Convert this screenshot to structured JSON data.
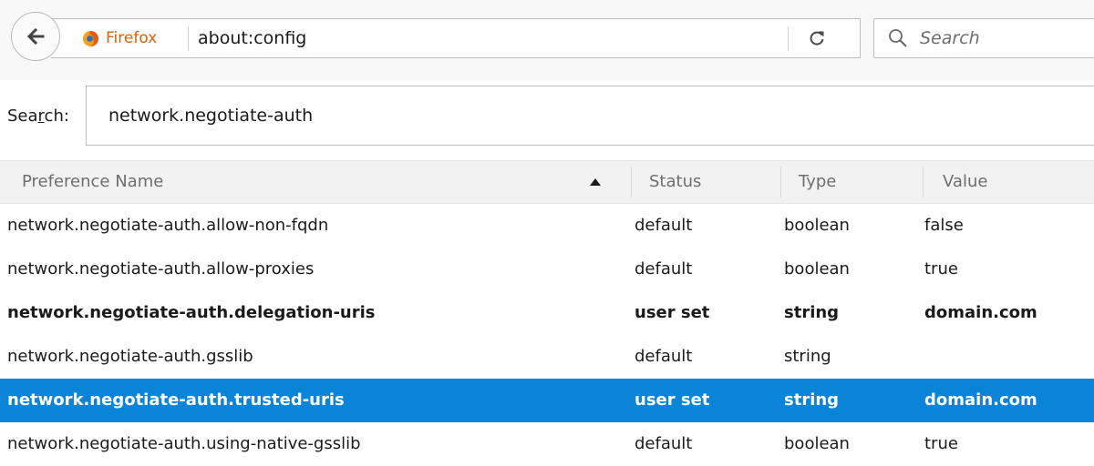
{
  "toolbar": {
    "identity_label": "Firefox",
    "url": "about:config",
    "search_placeholder": "Search"
  },
  "filter": {
    "label_before": "Sea",
    "label_access_key": "r",
    "label_after": "ch:",
    "value": "network.negotiate-auth"
  },
  "table": {
    "headers": {
      "name": "Preference Name",
      "status": "Status",
      "type": "Type",
      "value": "Value"
    },
    "rows": [
      {
        "name": "network.negotiate-auth.allow-non-fqdn",
        "status": "default",
        "type": "boolean",
        "value": "false"
      },
      {
        "name": "network.negotiate-auth.allow-proxies",
        "status": "default",
        "type": "boolean",
        "value": "true"
      },
      {
        "name": "network.negotiate-auth.delegation-uris",
        "status": "user set",
        "type": "string",
        "value": "domain.com"
      },
      {
        "name": "network.negotiate-auth.gsslib",
        "status": "default",
        "type": "string",
        "value": ""
      },
      {
        "name": "network.negotiate-auth.trusted-uris",
        "status": "user set",
        "type": "string",
        "value": "domain.com"
      },
      {
        "name": "network.negotiate-auth.using-native-gsslib",
        "status": "default",
        "type": "boolean",
        "value": "true"
      }
    ]
  },
  "colors": {
    "selection": "#0a84d6",
    "identity_orange": "#d7620b",
    "header_bg": "#f2f2f2"
  },
  "icons": [
    "back-arrow-icon",
    "firefox-logo-icon",
    "reload-icon",
    "search-icon",
    "sort-ascending-icon"
  ]
}
